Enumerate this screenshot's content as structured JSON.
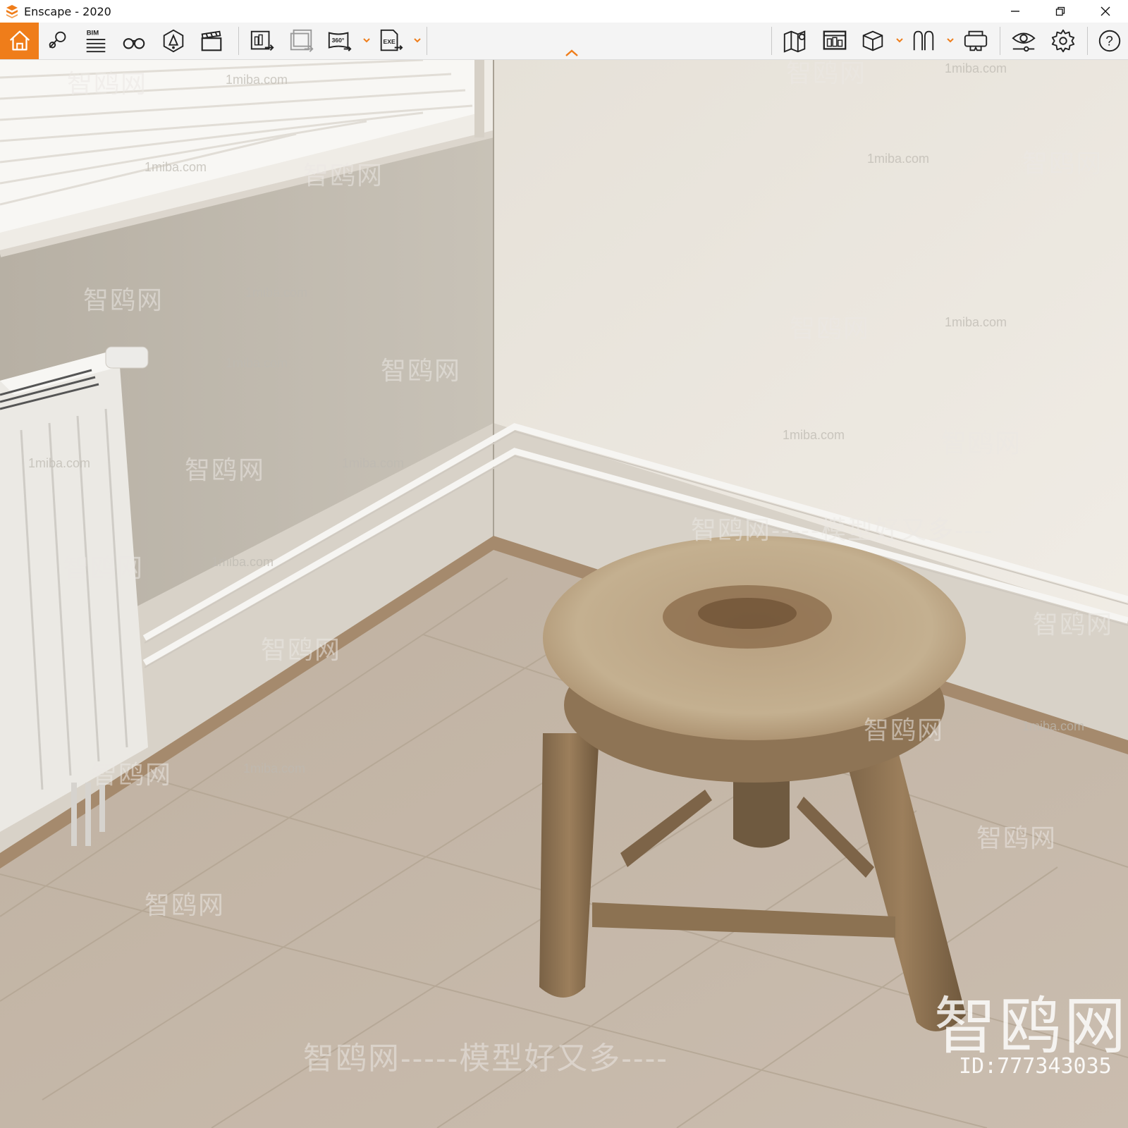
{
  "window": {
    "title": "Enscape - 2020",
    "accent_color": "#ef7d1a"
  },
  "toolbar": {
    "left_tools": [
      {
        "icon": "home-icon",
        "active": true
      },
      {
        "icon": "asset-library-icon"
      },
      {
        "icon": "bim-icon",
        "label": "BIM"
      },
      {
        "icon": "binoculars-icon"
      },
      {
        "icon": "atmosphere-icon"
      },
      {
        "icon": "clapperboard-icon"
      },
      {
        "icon": "screenshot-export-icon"
      },
      {
        "icon": "batch-export-icon"
      },
      {
        "icon": "panorama-360-icon",
        "label": "360°"
      },
      {
        "icon": "exe-export-icon",
        "label": "EXE"
      }
    ],
    "right_tools": [
      {
        "icon": "map-icon"
      },
      {
        "icon": "views-icon"
      },
      {
        "icon": "cube-icon"
      },
      {
        "icon": "orbit-icon"
      },
      {
        "icon": "vr-headset-icon"
      },
      {
        "icon": "visual-settings-icon"
      },
      {
        "icon": "settings-icon"
      },
      {
        "icon": "help-icon",
        "label": "?"
      }
    ]
  },
  "watermarks": {
    "domain": "1miba.com",
    "brand": "智鸥网",
    "slogan": "智鸥网-----模型好又多----",
    "logo_text": "智鸥网",
    "id_text": "ID:777343035"
  }
}
